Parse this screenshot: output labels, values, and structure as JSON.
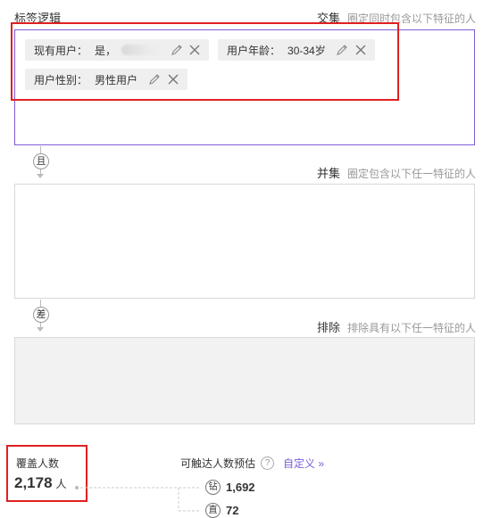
{
  "label_logic": {
    "title": "标签逻辑",
    "intersection": {
      "key": "交集",
      "hint": "圈定同时包含以下特征的人"
    },
    "union": {
      "key": "并集",
      "hint": "圈定包含以下任一特征的人"
    },
    "exclude": {
      "key": "排除",
      "hint": "排除具有以下任一特征的人"
    }
  },
  "tags": [
    {
      "label": "现有用户：",
      "value": "是，"
    },
    {
      "label": "用户年龄：",
      "value": "30-34岁"
    },
    {
      "label": "用户性别：",
      "value": "男性用户"
    }
  ],
  "connectors": {
    "and": "且",
    "diff": "差"
  },
  "coverage": {
    "label": "覆盖人数",
    "count": "2,178",
    "unit": "人"
  },
  "reach": {
    "title": "可触达人数预估",
    "help": "?",
    "custom_link": "自定义",
    "items": [
      {
        "badge": "钻",
        "value": "1,692"
      },
      {
        "badge": "直",
        "value": "72"
      }
    ]
  },
  "colors": {
    "accent": "#7c5cd9",
    "highlight": "#e02020",
    "tag_bg": "#efefef"
  },
  "icons": [
    "pencil-icon",
    "close-icon",
    "help-icon",
    "double-chevron-right-icon"
  ]
}
